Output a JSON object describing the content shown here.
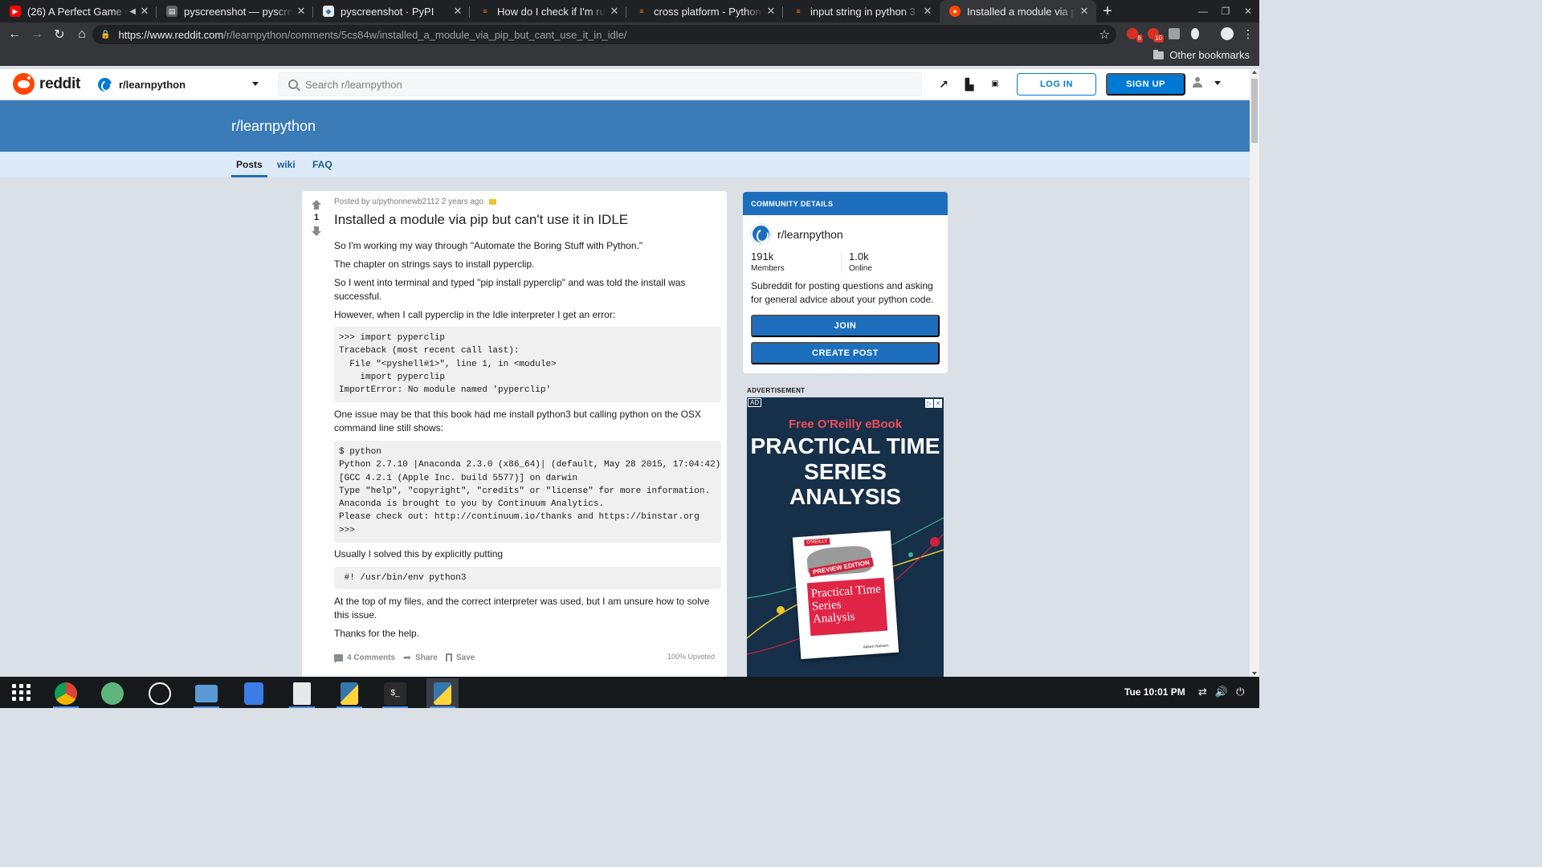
{
  "browser": {
    "tabs": [
      {
        "title": "(26) A Perfect Game of",
        "favicon_color": "#ff0000",
        "active": false,
        "audio": true
      },
      {
        "title": "pyscreenshot — pyscreen",
        "favicon_color": "#5f6368",
        "active": false
      },
      {
        "title": "pyscreenshot · PyPI",
        "favicon_color": "#e8eaed",
        "active": false
      },
      {
        "title": "How do I check if I'm runn",
        "favicon_color": "#f48024",
        "active": false
      },
      {
        "title": "cross platform - Python: W",
        "favicon_color": "#f48024",
        "active": false
      },
      {
        "title": "input string in python 3 - S",
        "favicon_color": "#f48024",
        "active": false
      },
      {
        "title": "Installed a module via pip",
        "favicon_color": "#ff4500",
        "active": true
      }
    ],
    "url_host": "https://www.reddit.com",
    "url_path": "/r/learnpython/comments/5cs84w/installed_a_module_via_pip_but_cant_use_it_in_idle/",
    "extension_badges": [
      "6",
      "10"
    ],
    "bookmarks_other": "Other bookmarks"
  },
  "reddit_header": {
    "wordmark": "reddit",
    "community": "r/learnpython",
    "search_placeholder": "Search r/learnpython",
    "login": "LOG IN",
    "signup": "SIGN UP"
  },
  "banner": {
    "title": "r/learnpython"
  },
  "subnav": {
    "items": [
      "Posts",
      "wiki",
      "FAQ"
    ],
    "active": "Posts"
  },
  "post": {
    "score": "1",
    "meta": "Posted by u/pythonnewb2112 2 years ago",
    "title": "Installed a module via pip but can't use it in IDLE",
    "p1": "So I'm working my way through \"Automate the Boring Stuff with Python.\"",
    "p2": "The chapter on strings says to install pyperclip.",
    "p3": "So I went into terminal and typed \"pip install pyperclip\" and was told the install was successful.",
    "p4": "However, when I call pyperclip in the Idle interpreter I get an error:",
    "code1": ">>> import pyperclip\nTraceback (most recent call last):\n  File \"<pyshell#1>\", line 1, in <module>\n    import pyperclip\nImportError: No module named 'pyperclip'",
    "p5": "One issue may be that this book had me install python3 but calling python on the OSX command line still shows:",
    "code2": "$ python\nPython 2.7.10 |Anaconda 2.3.0 (x86_64)| (default, May 28 2015, 17:04:42)\n[GCC 4.2.1 (Apple Inc. build 5577)] on darwin\nType \"help\", \"copyright\", \"credits\" or \"license\" for more information.\nAnaconda is brought to you by Continuum Analytics.\nPlease check out: http://continuum.io/thanks and https://binstar.org\n>>>",
    "p6": "Usually I solved this by explicitly putting",
    "code3": " #! /usr/bin/env python3",
    "p7": "At the top of my files, and the correct interpreter was used, but I am unsure how to solve this issue.",
    "p8": "Thanks for the help.",
    "comments": "4 Comments",
    "share": "Share",
    "save": "Save",
    "upvoted": "100% Upvoted"
  },
  "community": {
    "header": "COMMUNITY DETAILS",
    "name": "r/learnpython",
    "members_value": "191k",
    "members_label": "Members",
    "online_value": "1.0k",
    "online_label": "Online",
    "description": "Subreddit for posting questions and asking for general advice about your python code.",
    "join": "JOIN",
    "create_post": "CREATE POST"
  },
  "ad": {
    "label": "ADVERTISEMENT",
    "tag": "AD",
    "eyebrow": "Free O'Reilly eBook",
    "headline": "PRACTICAL TIME SERIES ANALYSIS",
    "book_brand": "O'REILLY",
    "book_badge": "PREVIEW EDITION",
    "book_title": "Practical Time Series Analysis",
    "book_author": "Aileen Nielsen"
  },
  "taskbar": {
    "clock": "Tue 10:01 PM"
  },
  "colors": {
    "reddit_orange": "#ff4500",
    "reddit_blue": "#0079d3",
    "banner": "#3a7bb8",
    "subnav_bg": "#dcebf7"
  }
}
